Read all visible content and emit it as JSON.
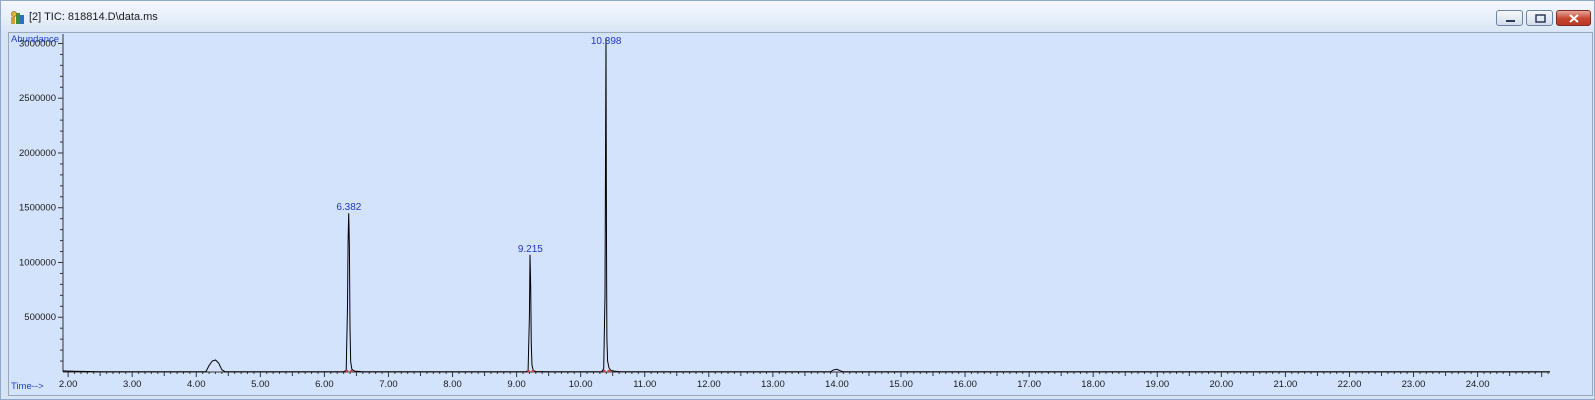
{
  "window": {
    "title": "[2] TIC: 818814.D\\data.ms",
    "buttons": {
      "minimize": "minimize",
      "maximize": "maximize",
      "close": "close"
    }
  },
  "chart_data": {
    "type": "line",
    "ylabel": "Abundance",
    "xlabel": "Time-->",
    "xlim": [
      1.92,
      25.13
    ],
    "ylim": [
      0,
      3050000
    ],
    "x_ticks": [
      "2.00",
      "3.00",
      "4.00",
      "5.00",
      "6.00",
      "7.00",
      "8.00",
      "9.00",
      "10.00",
      "11.00",
      "12.00",
      "13.00",
      "14.00",
      "15.00",
      "16.00",
      "17.00",
      "18.00",
      "19.00",
      "20.00",
      "21.00",
      "22.00",
      "23.00",
      "24.00"
    ],
    "x_tick_values": [
      2,
      3,
      4,
      5,
      6,
      7,
      8,
      9,
      10,
      11,
      12,
      13,
      14,
      15,
      16,
      17,
      18,
      19,
      20,
      21,
      22,
      23,
      24
    ],
    "y_ticks": [
      "500000",
      "1000000",
      "1500000",
      "2000000",
      "2500000",
      "3000000"
    ],
    "y_tick_values": [
      500000,
      1000000,
      1500000,
      2000000,
      2500000,
      3000000
    ],
    "peaks": [
      {
        "label": "6.382",
        "rt": 6.382,
        "height": 1450000
      },
      {
        "label": "9.215",
        "rt": 9.215,
        "height": 1070000
      },
      {
        "label": "10.398",
        "rt": 10.398,
        "height": 3050000
      }
    ],
    "series": [
      {
        "x": [
          1.92,
          2.0,
          2.3,
          2.5,
          4.15,
          4.2,
          4.25,
          4.3,
          4.35,
          4.4,
          4.45,
          6.3,
          6.34,
          6.36,
          6.37,
          6.38,
          6.39,
          6.4,
          6.41,
          6.43,
          6.47,
          6.6,
          9.15,
          9.18,
          9.2,
          9.21,
          9.22,
          9.23,
          9.24,
          9.26,
          9.3,
          9.5,
          10.33,
          10.36,
          10.38,
          10.39,
          10.395,
          10.4,
          10.405,
          10.41,
          10.42,
          10.44,
          10.47,
          10.52,
          10.6,
          10.75,
          11.0,
          13.9,
          13.95,
          14.0,
          14.05,
          14.1,
          25.13
        ],
        "y": [
          10000,
          8000,
          5000,
          3000,
          3000,
          60000,
          100000,
          110000,
          80000,
          20000,
          3000,
          3000,
          15000,
          600000,
          1200000,
          1450000,
          1150000,
          400000,
          90000,
          25000,
          8000,
          3000,
          3000,
          15000,
          500000,
          1070000,
          780000,
          250000,
          60000,
          15000,
          5000,
          3000,
          3000,
          30000,
          700000,
          2150000,
          3050000,
          1850000,
          900000,
          300000,
          100000,
          40000,
          15000,
          8000,
          4000,
          3000,
          2000,
          2000,
          20000,
          25000,
          12000,
          2000,
          2000
        ]
      }
    ],
    "grid": false,
    "line_color": "#000000",
    "label_color": "#2137c9",
    "background_color": "#d4e3fc"
  }
}
